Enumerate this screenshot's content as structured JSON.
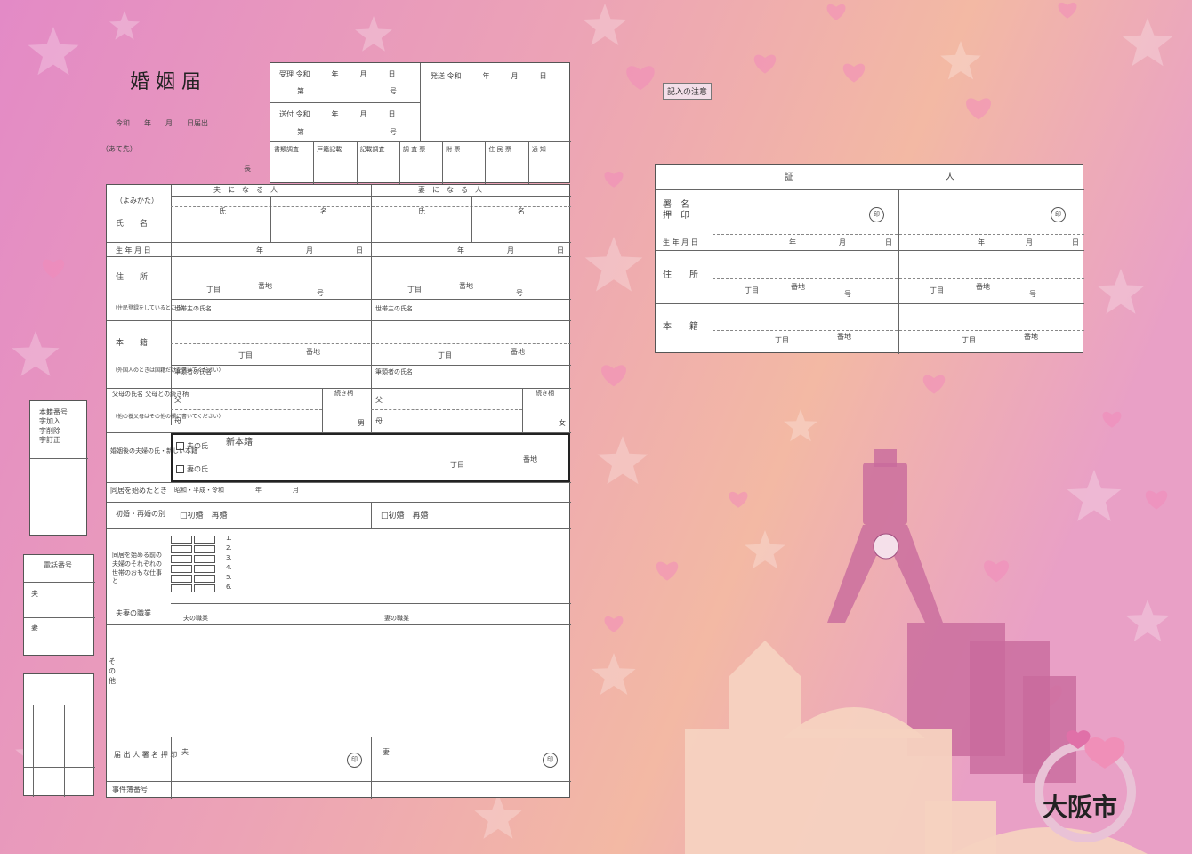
{
  "form": {
    "title": "婚 姻 届",
    "date_line": "令和　　年　　月　　日届出",
    "addressee": "（あて先）",
    "chief": "長",
    "reception": {
      "received": "受理 令和　　　年　　　月　　　日",
      "no_1": "第　　　　　　　　　　　　号",
      "sent": "送付 令和　　　年　　　月　　　日",
      "no_2": "第　　　　　　　　　　　　号",
      "issued": "発送 令和　　　年　　　月　　　日",
      "checks": [
        "書類調査",
        "戸籍記載",
        "記載調査",
        "調 査 票",
        "附 票",
        "住 民 票",
        "通 知"
      ]
    },
    "col_husband": "夫　に　な　る　人",
    "col_wife": "妻　に　な　る　人",
    "labels": {
      "yomikata": "（よみかた）",
      "name": "氏　　名",
      "birth": "生 年 月 日",
      "address": "住　　所",
      "address_note": "（住民登録をしているところ）",
      "honseki": "本　　籍",
      "honseki_note": "（外国人のときは国籍だけを書いてください）",
      "parents": "父母の氏名 父母との続き柄",
      "parents_note": "（他の養父母はその他の欄に書いてください）",
      "surname": "婚姻後の夫婦の氏・新しい本籍",
      "cohabit": "同居を始めたとき",
      "marital": "初婚・再婚の別",
      "occupation_before": "同居を始める前の夫婦のそれぞれの世帯のおもな仕事と",
      "occupation": "夫妻の職業",
      "other": "そ\nの\n他",
      "signature": "届 出 人 署 名 押 印",
      "reg_no": "事件簿番号"
    },
    "small": {
      "uji": "氏",
      "mei": "名",
      "year": "年",
      "month": "月",
      "day": "日",
      "chome": "丁目",
      "banchi": "番地",
      "ban": "番",
      "go": "号",
      "householder": "世帯主の氏名",
      "head": "筆頭者の氏名",
      "father": "父",
      "mother": "母",
      "relation": "続き柄",
      "male": "男",
      "female": "女",
      "husband_surname": "夫の氏",
      "wife_surname": "妻の氏",
      "new_honseki": "新本籍",
      "cohabit_date": "昭和・平成・令和　　　　　年　　　　　月",
      "first": "□初婚　再婚",
      "husband": "夫",
      "wife": "妻",
      "seal": "印",
      "husband_job": "夫の職業",
      "wife_job": "妻の職業"
    },
    "jobs": [
      "1.",
      "2.",
      "3.",
      "4.",
      "5.",
      "6."
    ]
  },
  "sidebar": {
    "registry_box": "本籍番号\n字加入\n字削除\n字訂正",
    "phone_box": "電話番号",
    "phone_husband": "夫",
    "phone_wife": "妻"
  },
  "notes": {
    "title": "記入の注意"
  },
  "witness": {
    "header_left": "証",
    "header_right": "人",
    "sign": "署　名\n押　印",
    "birth": "生 年 月 日",
    "address": "住　　所",
    "honseki": "本　　籍",
    "seal": "印",
    "year": "年",
    "month": "月",
    "day": "日",
    "chome": "丁目",
    "banchi": "番地",
    "ban": "番",
    "go": "号"
  },
  "logo": {
    "city": "大阪市"
  },
  "colors": {
    "bg_left": "#e792c9",
    "bg_mid": "#f1b0b0",
    "bg_right": "#f3bfa8",
    "heart": "#f08fb8",
    "building": "#f3d8c2",
    "tower": "#c86a9c"
  }
}
